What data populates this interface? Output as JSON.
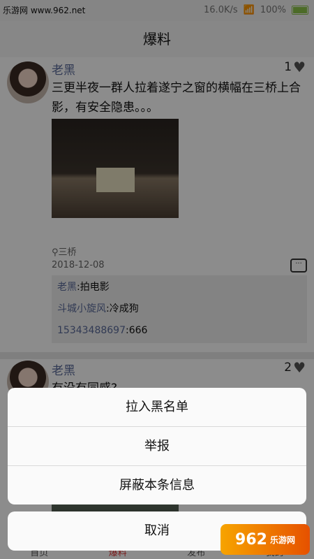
{
  "watermark_top": "乐游网 www.962.net",
  "status": {
    "speed": "16.0K/s",
    "battery": "100%"
  },
  "header": {
    "title": "爆料"
  },
  "posts": [
    {
      "author": "老黑",
      "likes": "1",
      "text": "三更半夜一群人拉着遂宁之窗的横幅在三桥上合影，有安全隐患。。。",
      "location": "三桥",
      "date": "2018-12-08",
      "comments": [
        {
          "user": "老黑",
          "text": ":拍电影"
        },
        {
          "user": "斗城小旋风",
          "text": ":冷成狗"
        },
        {
          "user": "15343488697",
          "text": ":666"
        }
      ]
    },
    {
      "author": "老黑",
      "likes": "2",
      "text": "有没有同感?"
    }
  ],
  "bottom_nav": [
    "首页",
    "爆料",
    "发布",
    "我的"
  ],
  "action_sheet": {
    "items": [
      "拉入黑名单",
      "举报",
      "屏蔽本条信息"
    ],
    "cancel": "取消"
  },
  "watermark": {
    "main": "962",
    "sub": "乐游网"
  },
  "icons": {
    "like": "heart-icon",
    "comment": "comment-icon",
    "location": "location-pin-icon"
  },
  "colors": {
    "username": "#5a6a9a",
    "overlay": "rgba(0,0,0,0.45)",
    "sheet": "#fafafa"
  }
}
